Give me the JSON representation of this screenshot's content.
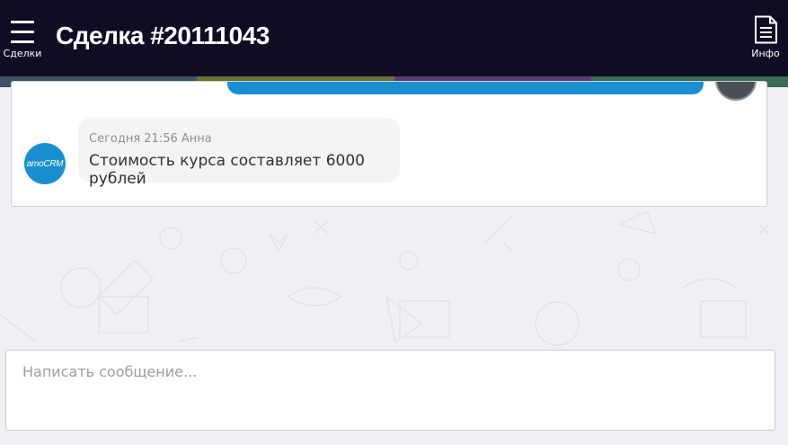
{
  "header": {
    "menu_label": "Сделки",
    "title": "Сделка #20111043",
    "info_label": "Инфо",
    "background": "#0f0c24"
  },
  "strip_colors": [
    "#3e5266",
    "#657334",
    "#5b3a74",
    "#3a6b56"
  ],
  "chat": {
    "incoming": {
      "avatar_text": "amoCRM",
      "meta": "Сегодня 21:56 Анна",
      "text": "Стоимость курса составляет 6000 рублей",
      "avatar_color": "#1a8fd0"
    },
    "outgoing_bubble_color": "#1a8fd0"
  },
  "composer": {
    "placeholder": "Написать сообщение...",
    "value": ""
  },
  "icons": [
    "menu-icon",
    "document-icon"
  ]
}
